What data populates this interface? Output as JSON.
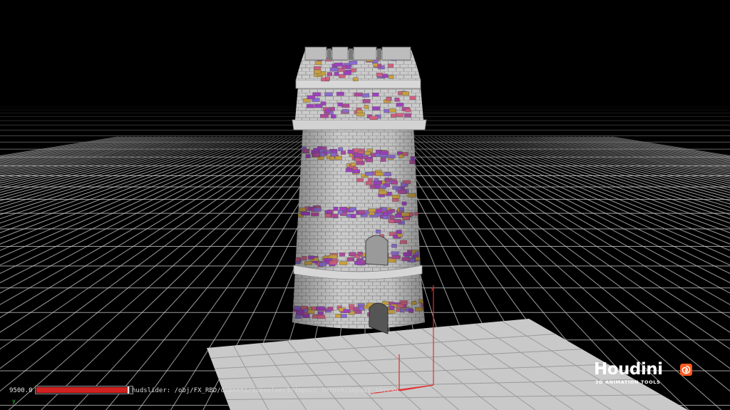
{
  "viewport": {
    "background": "#000000",
    "grid_color": "#cfcfcf",
    "ground_plane_color": "#cfcfcf",
    "tower_color": "#c8c8c8",
    "fracture_colors": [
      "#a040c0",
      "#c8a040",
      "#d06080",
      "#8a6ad0",
      "#b04a9a"
    ]
  },
  "hud": {
    "slider_value": "9500.0",
    "slider_fraction": 0.97,
    "slider_color": "#d02020",
    "path_text": "hudslider: /obj/FX_RBD/dopnet1/sopsolver1/impact_thresh/impact_thresh",
    "axis_label": "y",
    "axis_color": "#3ad13a"
  },
  "branding": {
    "title": "Houdini",
    "subtitle": "3D ANIMATION TOOLS",
    "logo_icon": "houdini-swirl-icon",
    "logo_color": "#ff5a1f"
  }
}
